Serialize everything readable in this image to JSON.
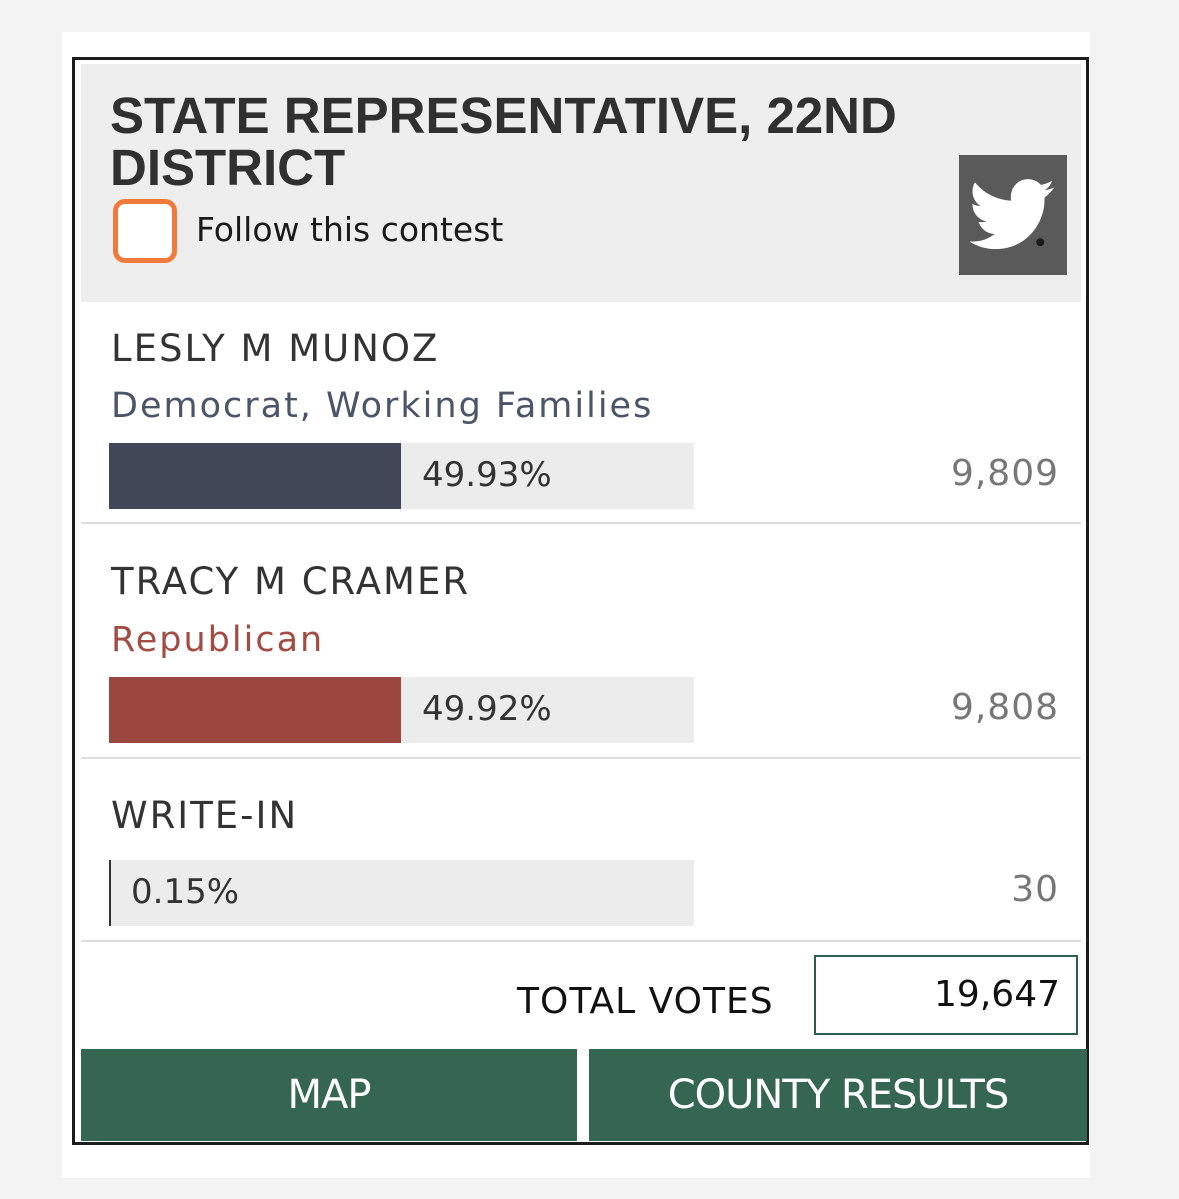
{
  "contest": {
    "title": "STATE REPRESENTATIVE, 22ND DISTRICT",
    "follow_label": "Follow this contest",
    "follow_checked": false
  },
  "candidates": [
    {
      "name": "LESLY M MUNOZ",
      "party": "Democrat, Working Families",
      "party_color": "#4a5568",
      "bar_color": "#414756",
      "percent": "49.93%",
      "share": 0.4993,
      "votes": "9,809"
    },
    {
      "name": "TRACY M CRAMER",
      "party": "Republican",
      "party_color": "#a24d44",
      "bar_color": "#9b463e",
      "percent": "49.92%",
      "share": 0.4992,
      "votes": "9,808"
    },
    {
      "name": "WRITE-IN",
      "percent": "0.15%",
      "share": 0.0015,
      "votes": "30"
    }
  ],
  "totals": {
    "label": "TOTAL VOTES",
    "value": "19,647"
  },
  "buttons": {
    "map": "MAP",
    "county": "COUNTY RESULTS"
  },
  "icons": {
    "share": "twitter-bird-icon"
  },
  "colors": {
    "accent_green": "#356652",
    "checkbox_orange": "#f07a3c"
  }
}
